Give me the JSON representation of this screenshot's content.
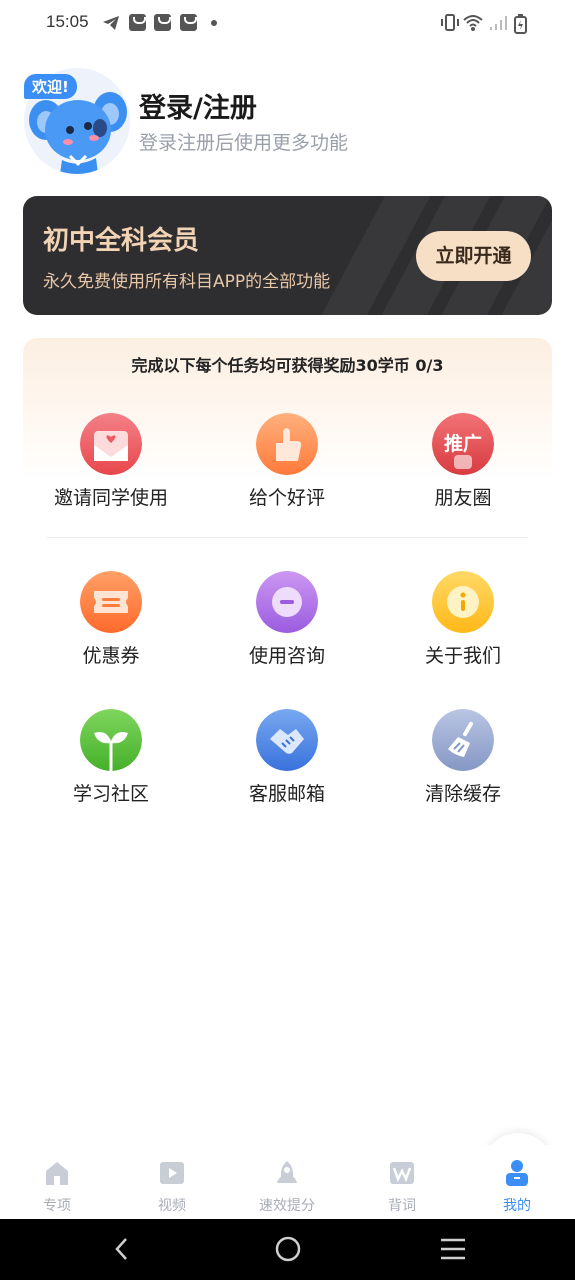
{
  "status_bar": {
    "time": "15:05",
    "icons": [
      "telegram-icon",
      "notification-icon",
      "notification-icon",
      "notification-icon",
      "dot-icon",
      "vibrate-icon",
      "wifi-icon",
      "signal-icon",
      "battery-charging-icon"
    ]
  },
  "profile": {
    "welcome_badge": "欢迎!",
    "title": "登录/注册",
    "subtitle": "登录注册后使用更多功能",
    "avatar": "koala-mascot-avatar"
  },
  "vip": {
    "title": "初中全科会员",
    "subtitle": "永久免费使用所有科目APP的全部功能",
    "button": "立即开通",
    "colors": {
      "background": "#2e2e31",
      "title": "#f2d3b4",
      "button": "#f7dfc6"
    }
  },
  "tasks": {
    "header": "完成以下每个任务均可获得奖励30学币 0/3",
    "items": [
      {
        "label": "邀请同学使用",
        "icon": "invite-envelope-icon",
        "color": "#ef5a5f"
      },
      {
        "label": "给个好评",
        "icon": "thumbs-up-icon",
        "color": "#ff8f54"
      },
      {
        "label": "朋友圈",
        "icon": "promote-icon",
        "icon_text": "推广",
        "color": "#e8474c"
      }
    ]
  },
  "menu": {
    "items": [
      {
        "label": "优惠券",
        "icon": "coupon-icon",
        "color": "#ff7d3c"
      },
      {
        "label": "使用咨询",
        "icon": "chat-bubble-icon",
        "color": "#b071e6"
      },
      {
        "label": "关于我们",
        "icon": "info-icon",
        "color": "#ffc531"
      },
      {
        "label": "学习社区",
        "icon": "sprout-icon",
        "color": "#5bc23f"
      },
      {
        "label": "客服邮箱",
        "icon": "handshake-icon",
        "color": "#4d86e6"
      },
      {
        "label": "清除缓存",
        "icon": "broom-icon",
        "color": "#98a8cf"
      }
    ]
  },
  "bottom_nav": {
    "items": [
      {
        "label": "专项",
        "icon": "home-icon",
        "active": false
      },
      {
        "label": "视频",
        "icon": "video-icon",
        "active": false
      },
      {
        "label": "速效提分",
        "icon": "rocket-icon",
        "active": false
      },
      {
        "label": "背词",
        "icon": "word-icon",
        "active": false
      },
      {
        "label": "我的",
        "icon": "profile-icon",
        "active": true
      }
    ],
    "colors": {
      "inactive": "#a9adb6",
      "active": "#3a8ef5"
    }
  },
  "system_nav": [
    "back-icon",
    "home-circle-icon",
    "recents-menu-icon"
  ]
}
